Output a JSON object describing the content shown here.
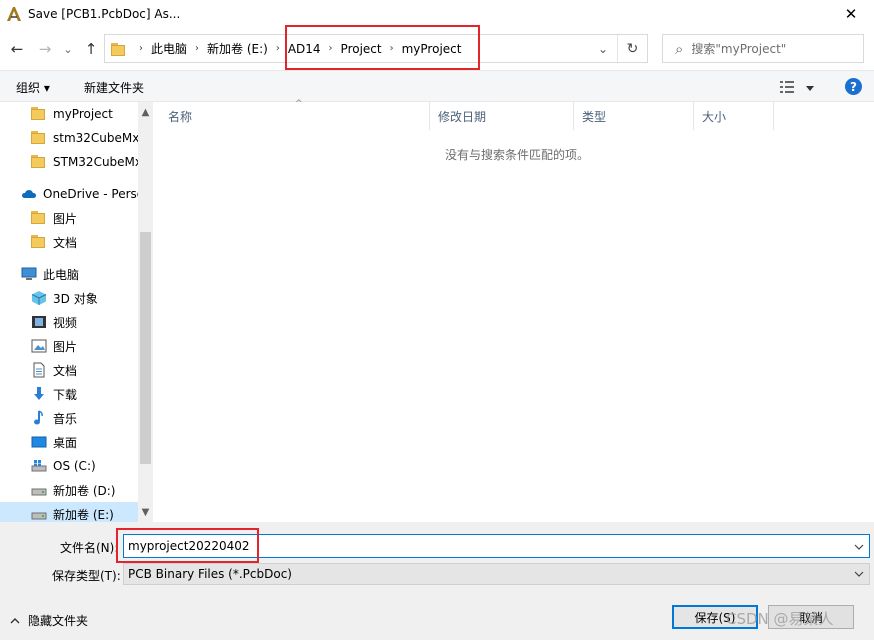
{
  "window": {
    "title": "Save [PCB1.PcbDoc] As...",
    "close_glyph": "✕"
  },
  "nav": {
    "back_glyph": "←",
    "forward_glyph": "→",
    "recent_glyph": "⌄",
    "up_glyph": "↑"
  },
  "address": {
    "crumbs": [
      "此电脑",
      "新加卷 (E:)",
      "AD14",
      "Project",
      "myProject"
    ],
    "separator": "›",
    "dropdown_glyph": "⌄",
    "refresh_glyph": "↻"
  },
  "search": {
    "placeholder": "搜索\"myProject\"",
    "icon_glyph": "⌕"
  },
  "toolbar": {
    "organize_label": "组织 ▾",
    "new_folder_label": "新建文件夹",
    "help_glyph": "?"
  },
  "sidebar": {
    "items": [
      {
        "label": "myProject",
        "icon": "folder-icon"
      },
      {
        "label": "stm32CubeMx",
        "icon": "folder-icon"
      },
      {
        "label": "STM32CubeMx",
        "icon": "folder-icon"
      },
      {
        "label": "OneDrive - Personal",
        "icon": "cloud-icon"
      },
      {
        "label": "图片",
        "icon": "folder-icon"
      },
      {
        "label": "文档",
        "icon": "folder-icon"
      },
      {
        "label": "此电脑",
        "icon": "computer-icon"
      },
      {
        "label": "3D 对象",
        "icon": "cube-icon"
      },
      {
        "label": "视频",
        "icon": "video-icon"
      },
      {
        "label": "图片",
        "icon": "picture-icon"
      },
      {
        "label": "文档",
        "icon": "document-icon"
      },
      {
        "label": "下载",
        "icon": "download-icon"
      },
      {
        "label": "音乐",
        "icon": "music-icon"
      },
      {
        "label": "桌面",
        "icon": "desktop-icon"
      },
      {
        "label": "OS (C:)",
        "icon": "windows-drive-icon"
      },
      {
        "label": "新加卷 (D:)",
        "icon": "drive-icon"
      },
      {
        "label": "新加卷 (E:)",
        "icon": "drive-icon"
      }
    ],
    "scroll_up_glyph": "▲",
    "scroll_down_glyph": "▼"
  },
  "filelist": {
    "columns": [
      "名称",
      "修改日期",
      "类型",
      "大小"
    ],
    "sort_glyph": "^",
    "empty_message": "没有与搜索条件匹配的项。"
  },
  "form": {
    "filename_label": "文件名(N):",
    "filename_value": "myproject20220402",
    "filetype_label": "保存类型(T):",
    "filetype_value": "PCB Binary Files (*.PcbDoc)"
  },
  "footer": {
    "hide_folders_label": "隐藏文件夹",
    "save_label": "保存(S)",
    "cancel_label": "取消",
    "watermark": "CSDN @易某人"
  },
  "colors": {
    "accent": "#0078d7",
    "highlight": "#e1252b",
    "selection": "#cce8ff"
  }
}
